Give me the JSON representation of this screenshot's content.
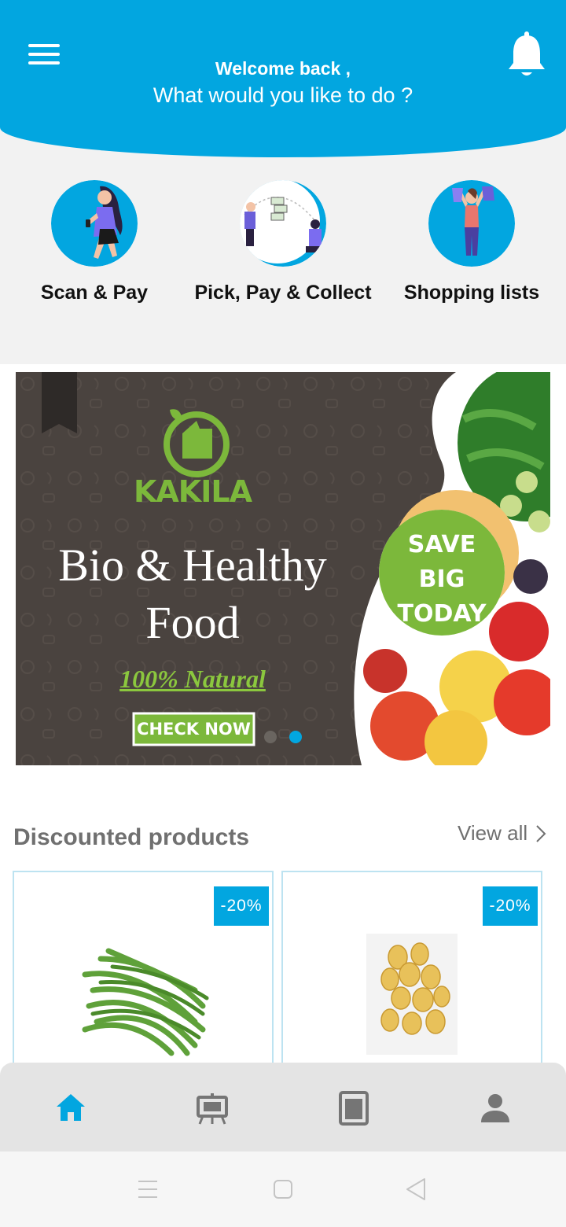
{
  "header": {
    "welcome": "Welcome back ,",
    "question": "What would you like to do ?",
    "accent": "#02a6e0"
  },
  "actions": [
    {
      "label": "Scan & Pay",
      "icon": "woman-scanning-phone-illustration"
    },
    {
      "label": "Pick, Pay & Collect",
      "icon": "money-transfer-illustration"
    },
    {
      "label": "Shopping lists",
      "icon": "woman-shopping-bags-illustration"
    }
  ],
  "banner": {
    "brand": "KAKILA",
    "headline_1": "Bio & Healthy",
    "headline_2": "Food",
    "tagline": "100% Natural",
    "cta": "CHECK NOW",
    "promo_1": "SAVE",
    "promo_2": "BIG",
    "promo_3": "TODAY",
    "active_slide": 2,
    "slide_count": 2
  },
  "discounted": {
    "title": "Discounted products",
    "view_all": "View all",
    "products": [
      {
        "badge": "-20%",
        "image": "green-beans-image"
      },
      {
        "badge": "-20%",
        "image": "potatoes-image"
      }
    ]
  },
  "bottom_nav": [
    "home-icon",
    "easel-icon",
    "tablet-icon",
    "person-icon"
  ],
  "system_nav": [
    "recents-icon",
    "home-square-icon",
    "back-icon"
  ]
}
